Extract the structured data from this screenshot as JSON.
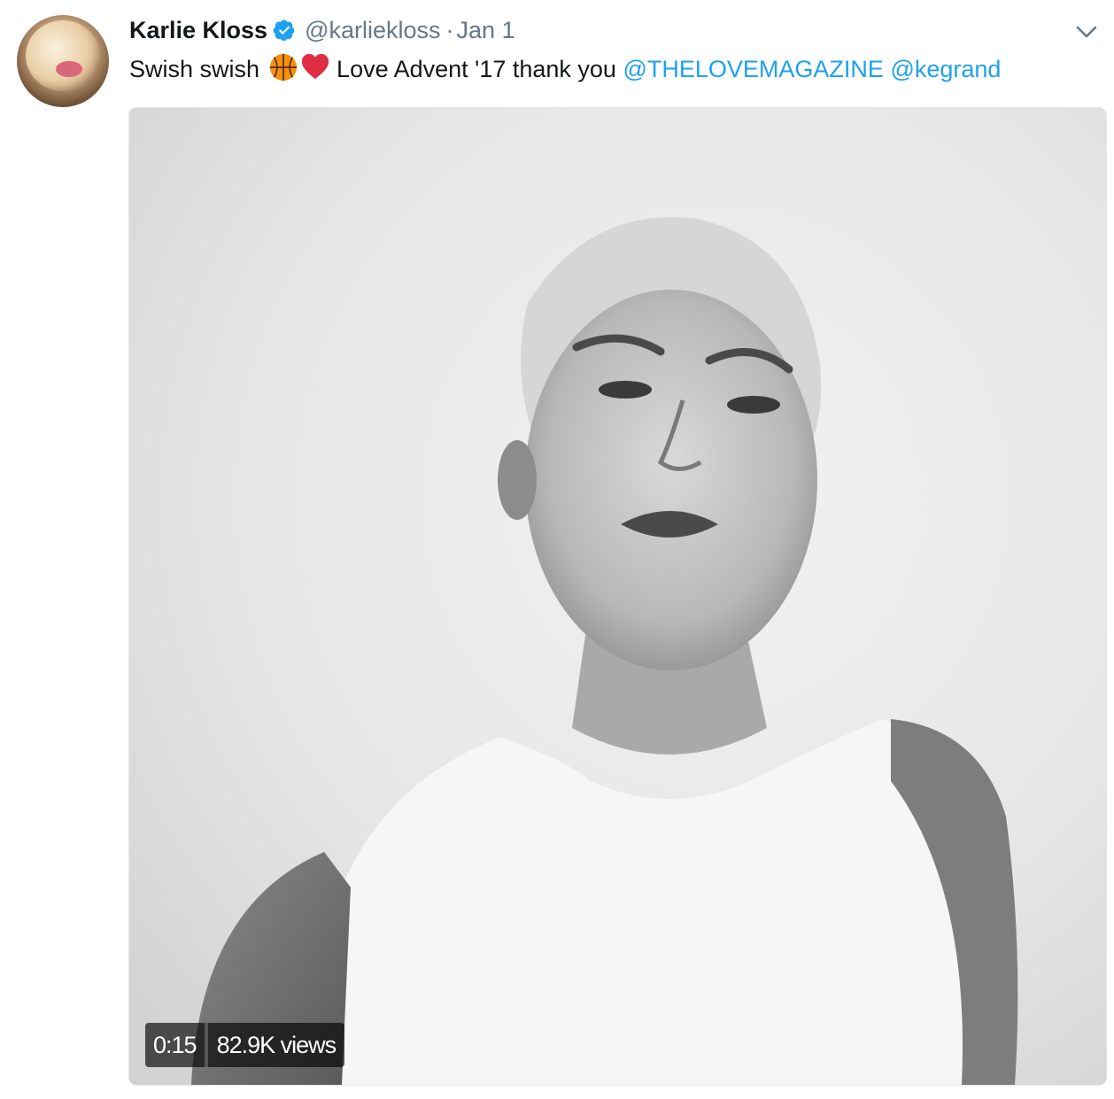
{
  "tweet": {
    "author": {
      "display_name": "Karlie Kloss",
      "handle": "@karliekloss",
      "verified": true,
      "avatar_icon": "profile-avatar"
    },
    "separator": "·",
    "timestamp": "Jan 1",
    "menu_icon": "chevron-down-icon",
    "text": {
      "prefix": "Swish swish ",
      "emojis": [
        "basketball-emoji",
        "red-heart-emoji"
      ],
      "middle": " Love Advent '17 thank you ",
      "mention_1": "@THELOVEMAGAZINE",
      "mention_2": "@kegrand"
    },
    "media": {
      "type": "video",
      "duration": "0:15",
      "views": "82.9K views"
    }
  },
  "colors": {
    "text_primary": "#14171a",
    "text_secondary": "#657786",
    "link": "#1da1f2",
    "verified_badge": "#1da1f2",
    "heart": "#e0245e"
  }
}
